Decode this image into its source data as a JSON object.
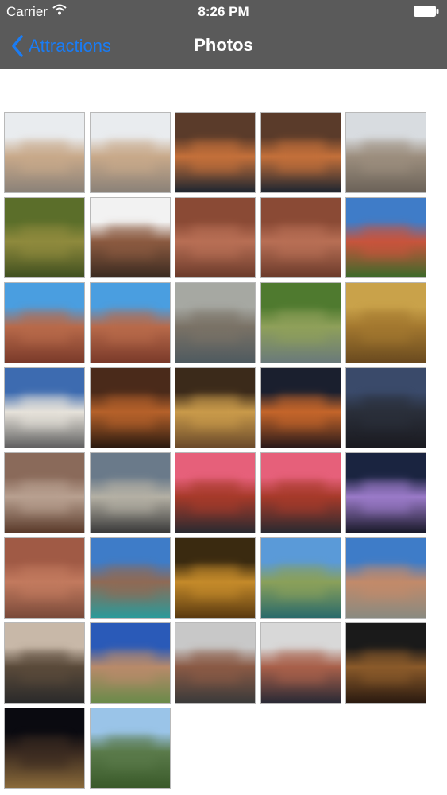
{
  "status": {
    "carrier": "Carrier",
    "time": "8:26 PM"
  },
  "nav": {
    "back_label": "Attractions",
    "title": "Photos"
  },
  "photos": [
    {
      "top": "#e9ecef",
      "mid": "#c8a98a",
      "bot": "#8a8178"
    },
    {
      "top": "#e9ecef",
      "mid": "#c8a98a",
      "bot": "#8a8178"
    },
    {
      "top": "#5a3b2a",
      "mid": "#c4703a",
      "bot": "#1d2530"
    },
    {
      "top": "#5a3b2a",
      "mid": "#c4703a",
      "bot": "#1d2530"
    },
    {
      "top": "#d8dce0",
      "mid": "#9c8e7e",
      "bot": "#6b6258"
    },
    {
      "top": "#5b6e2a",
      "mid": "#8f8a3d",
      "bot": "#3f4f1f"
    },
    {
      "top": "#f2f2f2",
      "mid": "#8b5a40",
      "bot": "#3a2a20"
    },
    {
      "top": "#8a4a35",
      "mid": "#b86f55",
      "bot": "#6a3a2a"
    },
    {
      "top": "#8a4a35",
      "mid": "#b86f55",
      "bot": "#6a3a2a"
    },
    {
      "top": "#3f7cc8",
      "mid": "#c8543c",
      "bot": "#3b6a2a"
    },
    {
      "top": "#4a9ee0",
      "mid": "#b86a4a",
      "bot": "#7a3a2a"
    },
    {
      "top": "#4a9ee0",
      "mid": "#b86a4a",
      "bot": "#7a3a2a"
    },
    {
      "top": "#a6a8a2",
      "mid": "#7a7266",
      "bot": "#4f5a5f"
    },
    {
      "top": "#4f7a2f",
      "mid": "#8fa05a",
      "bot": "#6a7a7a"
    },
    {
      "top": "#c9a24a",
      "mid": "#a3782f",
      "bot": "#6a4a1f"
    },
    {
      "top": "#3d6bb0",
      "mid": "#e6e2da",
      "bot": "#606060"
    },
    {
      "top": "#4a2a1a",
      "mid": "#b5612a",
      "bot": "#2a1a10"
    },
    {
      "top": "#3b2a1a",
      "mid": "#c99a4a",
      "bot": "#6a4a2a"
    },
    {
      "top": "#1a1f2e",
      "mid": "#c4652a",
      "bot": "#2a1a1a"
    },
    {
      "top": "#3a4a6a",
      "mid": "#2a2f3a",
      "bot": "#1a1a20"
    },
    {
      "top": "#8a6a5a",
      "mid": "#b8a090",
      "bot": "#5a3a2a"
    },
    {
      "top": "#6a7a8a",
      "mid": "#b4b0a4",
      "bot": "#3a3a3a"
    },
    {
      "top": "#e6607a",
      "mid": "#a63a2a",
      "bot": "#2a2a30"
    },
    {
      "top": "#e6607a",
      "mid": "#a63a2a",
      "bot": "#2a2a30"
    },
    {
      "top": "#1a2440",
      "mid": "#9a7ac8",
      "bot": "#1a1a2a"
    },
    {
      "top": "#a05a45",
      "mid": "#c27a5e",
      "bot": "#7a4a3a"
    },
    {
      "top": "#3e7cc8",
      "mid": "#8f6a55",
      "bot": "#2a9a9a"
    },
    {
      "top": "#3a2a10",
      "mid": "#c48a2a",
      "bot": "#5a3a10"
    },
    {
      "top": "#5a9ad8",
      "mid": "#8aa05a",
      "bot": "#2a6a6a"
    },
    {
      "top": "#3e7cc8",
      "mid": "#c28a6a",
      "bot": "#8a8a80"
    },
    {
      "top": "#c8b8a8",
      "mid": "#5a4a3a",
      "bot": "#2a2a2a"
    },
    {
      "top": "#2a5ab8",
      "mid": "#b88a6a",
      "bot": "#6a8a4a"
    },
    {
      "top": "#c8c8c8",
      "mid": "#8a5a45",
      "bot": "#3a3a3a"
    },
    {
      "top": "#d8d8d8",
      "mid": "#a8604a",
      "bot": "#2a2a35"
    },
    {
      "top": "#1a1a1a",
      "mid": "#8a5a2a",
      "bot": "#2a1a10"
    },
    {
      "top": "#0a0a10",
      "mid": "#3a2a20",
      "bot": "#8a6a3a"
    },
    {
      "top": "#9ac4e8",
      "mid": "#5a7a4a",
      "bot": "#3a5a2a"
    }
  ]
}
